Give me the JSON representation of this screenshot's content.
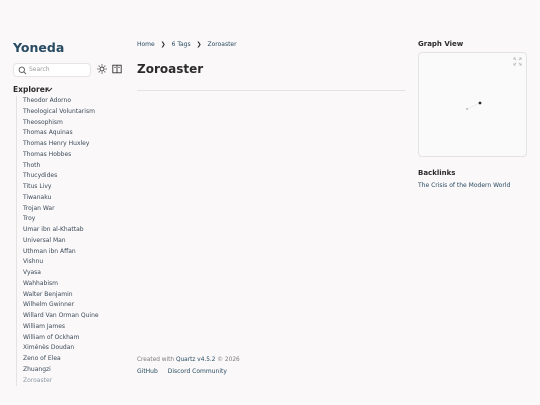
{
  "site": {
    "title": "Yoneda"
  },
  "search": {
    "placeholder": "Search"
  },
  "explorer": {
    "title": "Explorer",
    "items": [
      "Theodor Adorno",
      "Theological Voluntarism",
      "Theosophism",
      "Thomas Aquinas",
      "Thomas Henry Huxley",
      "Thomas Hobbes",
      "Thoth",
      "Thucydides",
      "Titus Livy",
      "Tiwanaku",
      "Trojan War",
      "Troy",
      "Umar ibn al-Khattab",
      "Universal Man",
      "Uthman ibn Affan",
      "Vishnu",
      "Vyasa",
      "Wahhabism",
      "Walter Benjamin",
      "Wilhelm Gwinner",
      "Willard Van Orman Quine",
      "William James",
      "William of Ockham",
      "Ximénès Doudan",
      "Zeno of Elea",
      "Zhuangzi",
      "Zoroaster"
    ]
  },
  "breadcrumb": {
    "home": "Home",
    "tags": "6 Tags",
    "current": "Zoroaster"
  },
  "page": {
    "title": "Zoroaster"
  },
  "footer": {
    "created_prefix": "Created with",
    "quartz": "Quartz v4.5.2",
    "year": "© 2026",
    "links": [
      "GitHub",
      "Discord Community"
    ]
  },
  "graph": {
    "title": "Graph View"
  },
  "backlinks": {
    "title": "Backlinks",
    "items": [
      "The Crisis of the Modern World"
    ]
  },
  "colors": {
    "accent": "#284b63",
    "text": "#2b2b2b",
    "border": "#e3e3e3",
    "background": "#faf8f8"
  }
}
